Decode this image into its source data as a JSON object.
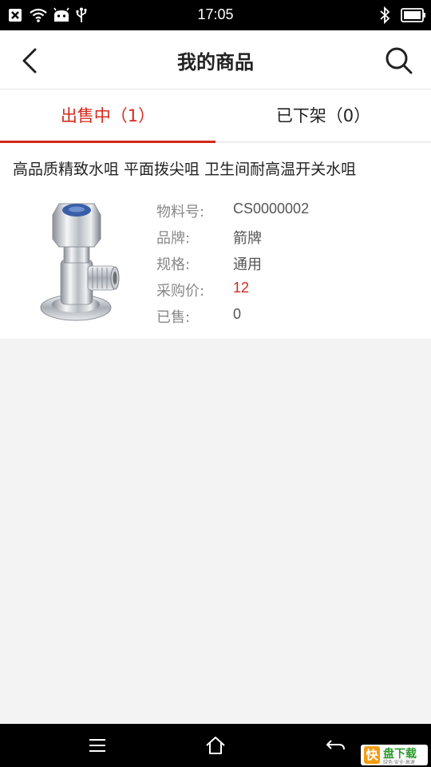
{
  "status_bar": {
    "time": "17:05",
    "left_icons": [
      "close-box-icon",
      "wifi-icon",
      "android-icon",
      "usb-icon"
    ],
    "right_icons": [
      "bluetooth-icon",
      "battery-icon"
    ]
  },
  "header": {
    "title": "我的商品",
    "back_icon": "chevron-left-icon",
    "search_icon": "search-icon"
  },
  "tabs": [
    {
      "label": "出售中（1）",
      "active": true
    },
    {
      "label": "已下架（0）",
      "active": false
    }
  ],
  "product": {
    "title": "高品质精致水咀 平面拨尖咀 卫生间耐高温开关水咀",
    "specs": [
      {
        "key": "物料号:",
        "value": "CS0000002"
      },
      {
        "key": "品牌:",
        "value": "箭牌"
      },
      {
        "key": "规格:",
        "value": "通用"
      },
      {
        "key": "采购价:",
        "value": "12"
      },
      {
        "key": "已售:",
        "value": "0"
      }
    ]
  },
  "nav_bar": {
    "icons": [
      "menu-icon",
      "home-icon",
      "back-arrow-icon"
    ]
  },
  "watermark": {
    "logo_char": "快",
    "text": "盘下载",
    "sub": "绿色·安全·高速"
  },
  "colors": {
    "accent": "#d4291c",
    "background": "#f3f3f3",
    "status_bar": "#000000"
  }
}
